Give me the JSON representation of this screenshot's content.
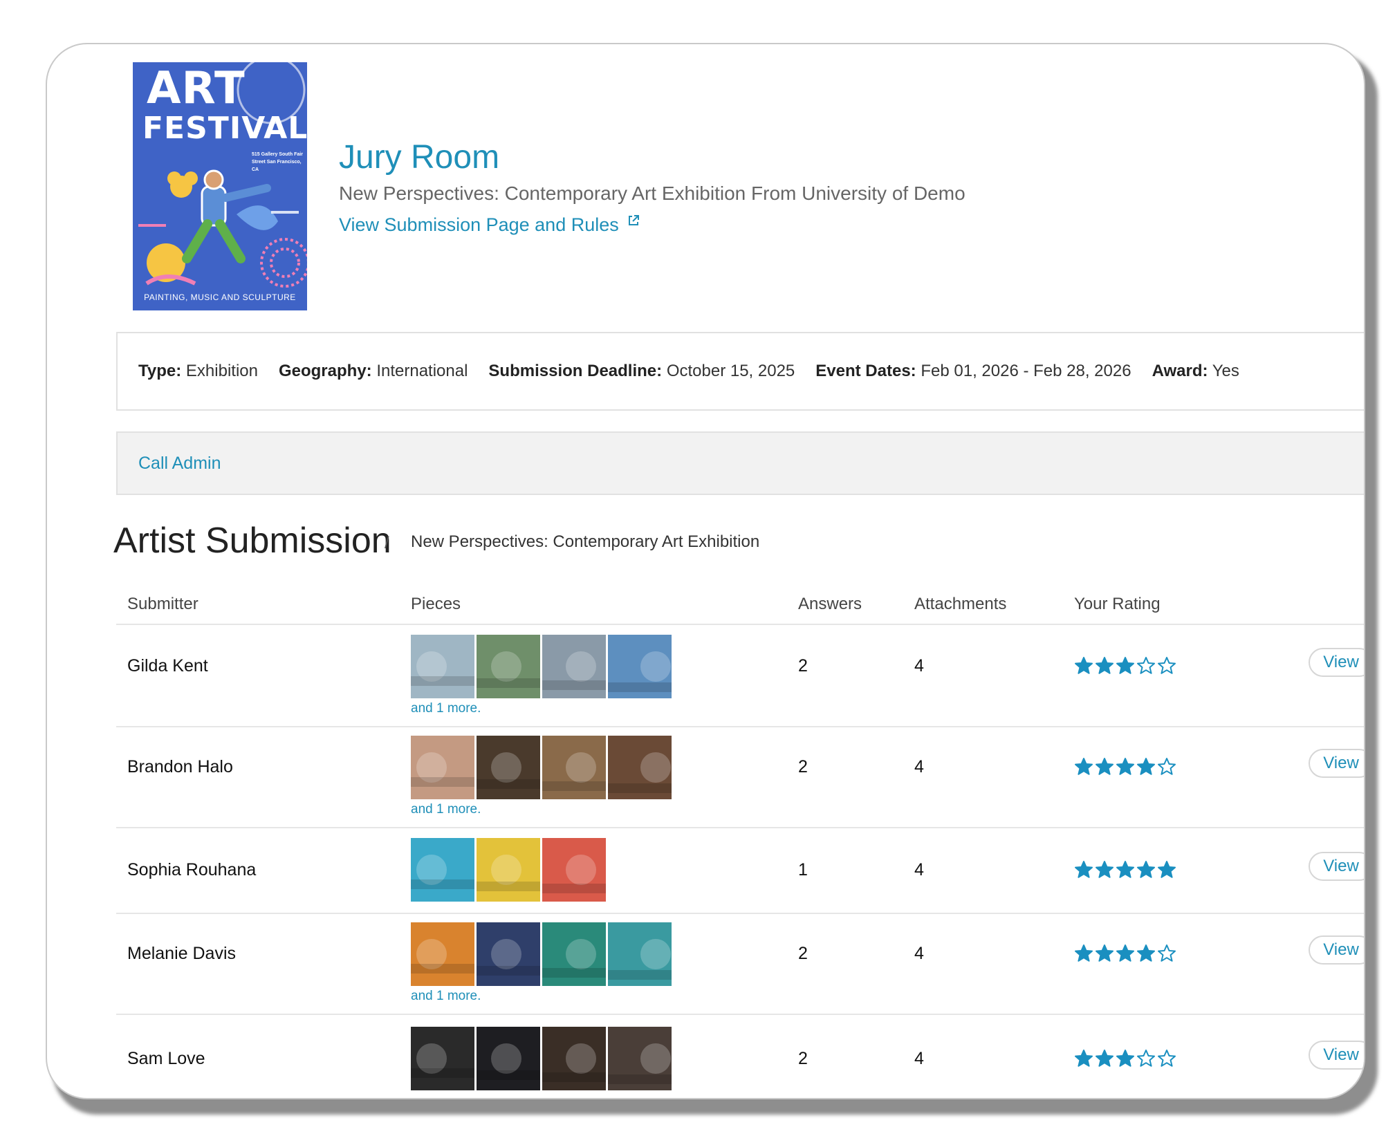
{
  "header": {
    "poster_title_line1": "ART",
    "poster_title_line2": "FESTIVAL",
    "poster_address": "515 Gallery South Fair Street San Francisco, CA",
    "poster_footer": "PAINTING, MUSIC AND SCULPTURE",
    "title": "Jury Room",
    "subtitle": "New Perspectives: Contemporary Art Exhibition From University of Demo",
    "link_label": "View Submission Page and Rules"
  },
  "info": {
    "type_label": "Type:",
    "type_value": "Exhibition",
    "geo_label": "Geography:",
    "geo_value": "International",
    "deadline_label": "Submission Deadline:",
    "deadline_value": "October 15, 2025",
    "event_label": "Event Dates:",
    "event_value": "Feb 01, 2026 - Feb 28, 2026",
    "award_label": "Award:",
    "award_value": "Yes"
  },
  "admin": {
    "link_label": "Call Admin"
  },
  "section": {
    "title": "Artist Submission",
    "separator": "/",
    "breadcrumb": "New Perspectives: Contemporary Art Exhibition"
  },
  "table": {
    "headers": {
      "submitter": "Submitter",
      "pieces": "Pieces",
      "answers": "Answers",
      "attachments": "Attachments",
      "rating": "Your Rating"
    },
    "view_label": "View",
    "rows": [
      {
        "name": "Gilda Kent",
        "answers": "2",
        "attachments": "4",
        "rating": 3,
        "more": "and 1 more.",
        "thumb_colors": [
          "#9fb6c4",
          "#6f8f6a",
          "#8a9aa8",
          "#5d8fbf"
        ]
      },
      {
        "name": "Brandon Halo",
        "answers": "2",
        "attachments": "4",
        "rating": 4,
        "more": "and 1 more.",
        "thumb_colors": [
          "#c49a82",
          "#4a3a2c",
          "#8a6a4a",
          "#6a4a36"
        ]
      },
      {
        "name": "Sophia Rouhana",
        "answers": "1",
        "attachments": "4",
        "rating": 5,
        "more": "",
        "thumb_colors": [
          "#3aa9c9",
          "#e3c23a",
          "#d95a4a"
        ]
      },
      {
        "name": "Melanie Davis",
        "answers": "2",
        "attachments": "4",
        "rating": 4,
        "more": "and 1 more.",
        "thumb_colors": [
          "#d9832e",
          "#2f3f6a",
          "#2a8a7a",
          "#3a9aa0"
        ]
      },
      {
        "name": "Sam Love",
        "answers": "2",
        "attachments": "4",
        "rating": 3,
        "more": "",
        "thumb_colors": [
          "#2a2a2a",
          "#1e1e22",
          "#3a2e26",
          "#4a3e38"
        ]
      }
    ]
  },
  "colors": {
    "accent": "#1f8fb8",
    "star": "#1a8fc0",
    "poster_bg": "#3f63c6"
  }
}
